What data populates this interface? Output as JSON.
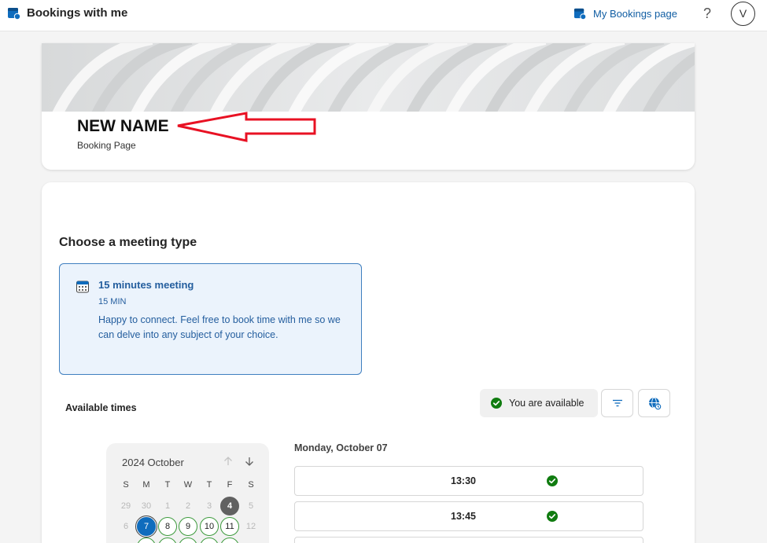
{
  "topbar": {
    "app_title": "Bookings with me",
    "my_bookings_label": "My Bookings page",
    "help_label": "?",
    "avatar_initial": "V"
  },
  "header": {
    "name": "NEW NAME",
    "subtitle": "Booking Page"
  },
  "main": {
    "section_title": "Choose a meeting type",
    "service": {
      "name": "15 minutes meeting",
      "duration": "15 MIN",
      "description": "Happy to connect. Feel free to book time with me so we can delve into any subject of your choice."
    },
    "available_times_label": "Available times",
    "status_label": "You are available",
    "calendar": {
      "title": "2024 October",
      "weekdays": [
        "S",
        "M",
        "T",
        "W",
        "T",
        "F",
        "S"
      ],
      "week1": [
        "29",
        "30",
        "1",
        "2",
        "3",
        "4",
        "5"
      ],
      "week2": [
        "6",
        "7",
        "8",
        "9",
        "10",
        "11",
        "12"
      ]
    },
    "times": {
      "date_label": "Monday, October 07",
      "slots": [
        "13:30",
        "13:45"
      ]
    }
  },
  "colors": {
    "accent": "#0f6cbd",
    "link": "#115ea3",
    "available_green": "#107c10",
    "annotation_red": "#e81123"
  }
}
